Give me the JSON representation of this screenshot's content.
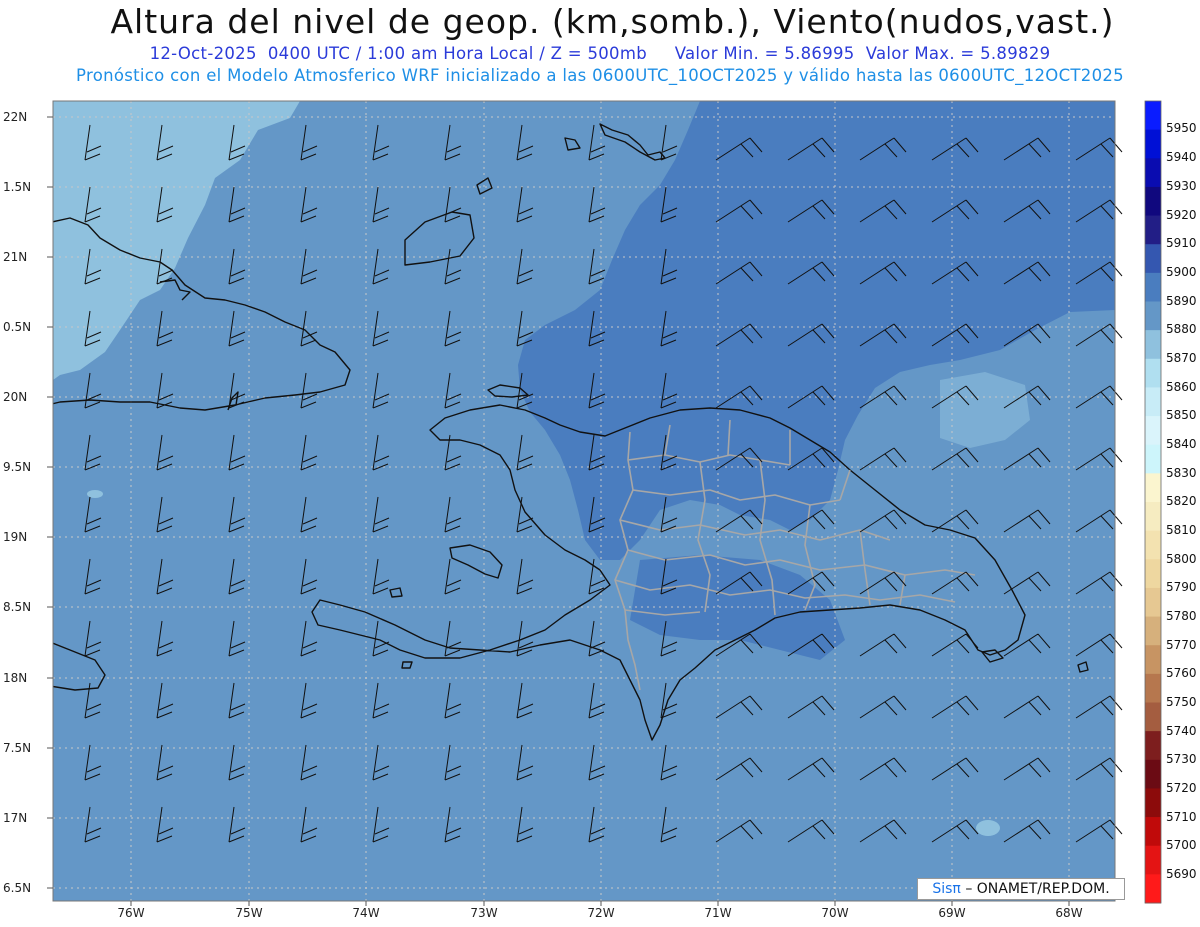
{
  "header": {
    "title": "Altura del nivel de geop. (km,somb.), Viento(nudos,vast.)",
    "subtitle": "12-Oct-2025  0400 UTC / 1:00 am Hora Local / Z = 500mb     Valor Min. = 5.86995  Valor Max. = 5.89829",
    "model_line": "Pronóstico con el Modelo Atmosferico WRF inicializado a las 0600UTC_10OCT2025 y válido hasta las  0600UTC_12OCT2025"
  },
  "axes": {
    "y_labels": [
      "22N",
      "1.5N",
      "21N",
      "0.5N",
      "20N",
      "9.5N",
      "19N",
      "8.5N",
      "18N",
      "7.5N",
      "17N",
      "6.5N"
    ],
    "x_labels": [
      "76W",
      "75W",
      "74W",
      "73W",
      "72W",
      "71W",
      "70W",
      "69W",
      "68W"
    ]
  },
  "colorbar": {
    "labels": [
      "5950",
      "5940",
      "5930",
      "5920",
      "5910",
      "5900",
      "5890",
      "5880",
      "5870",
      "5860",
      "5850",
      "5840",
      "5830",
      "5820",
      "5810",
      "5800",
      "5790",
      "5780",
      "5770",
      "5760",
      "5750",
      "5740",
      "5730",
      "5720",
      "5710",
      "5700",
      "5690"
    ],
    "colors": [
      "#0a1cff",
      "#0010d6",
      "#0a0cb0",
      "#10087e",
      "#221e86",
      "#3457b0",
      "#4a7dbf",
      "#6497c7",
      "#8fc1de",
      "#b0dff0",
      "#c8ecf7",
      "#daf4fb",
      "#cdf5fb",
      "#fbf5cf",
      "#f6ecc1",
      "#f3e2b0",
      "#eed7a0",
      "#e6c892",
      "#d6b07c",
      "#c79463",
      "#b6774e",
      "#a45d40",
      "#7d1e1e",
      "#6b0b14",
      "#8c0b0b",
      "#c00a0a",
      "#e41414",
      "#ff1a1a"
    ]
  },
  "colors": {
    "field_dark": "#4a7dbf",
    "field_mid": "#6497c7",
    "field_light": "#8fc1de",
    "land_border": "#111111",
    "province_border": "#a7a7a7"
  },
  "credit": {
    "sis": "Sisπ",
    "org": "– ONAMET/REP.DOM."
  }
}
